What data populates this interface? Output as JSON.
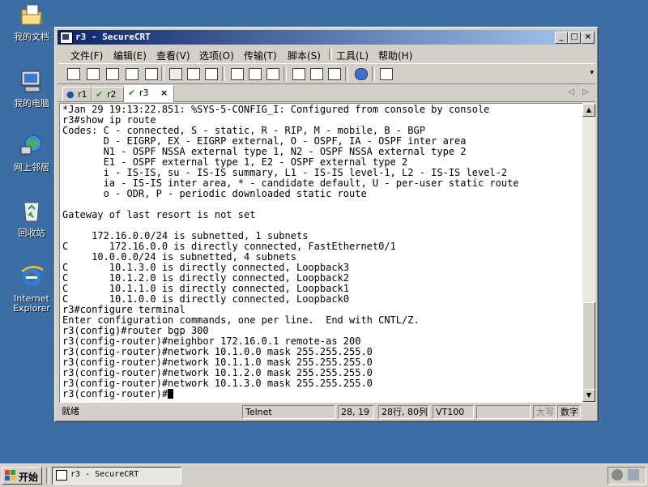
{
  "desktop": {
    "icons": [
      {
        "label": "我的文档",
        "icon": "my-documents-icon"
      },
      {
        "label": "我的电脑",
        "icon": "my-computer-icon"
      },
      {
        "label": "网上邻居",
        "icon": "network-icon"
      },
      {
        "label": "回收站",
        "icon": "recycle-bin-icon"
      },
      {
        "label": "Internet Explorer",
        "icon": "internet-explorer-icon"
      }
    ]
  },
  "window": {
    "title": "r3 - SecureCRT",
    "controls": {
      "minimize": "_",
      "maximize": "□",
      "close": "×"
    },
    "menu": [
      "文件(F)",
      "编辑(E)",
      "查看(V)",
      "选项(O)",
      "传输(T)",
      "脚本(S)",
      "工具(L)",
      "帮助(H)"
    ],
    "tabs": [
      {
        "label": "r1",
        "status": "info"
      },
      {
        "label": "r2",
        "status": "connected"
      },
      {
        "label": "r3",
        "status": "connected",
        "active": true,
        "close": "×"
      }
    ],
    "tab_nav": {
      "left": "◁",
      "right": "▷"
    }
  },
  "terminal": {
    "lines": [
      "*Jan 29 19:13:22.851: %SYS-5-CONFIG_I: Configured from console by console",
      "r3#show ip route",
      "Codes: C - connected, S - static, R - RIP, M - mobile, B - BGP",
      "       D - EIGRP, EX - EIGRP external, O - OSPF, IA - OSPF inter area",
      "       N1 - OSPF NSSA external type 1, N2 - OSPF NSSA external type 2",
      "       E1 - OSPF external type 1, E2 - OSPF external type 2",
      "       i - IS-IS, su - IS-IS summary, L1 - IS-IS level-1, L2 - IS-IS level-2",
      "       ia - IS-IS inter area, * - candidate default, U - per-user static route",
      "       o - ODR, P - periodic downloaded static route",
      "",
      "Gateway of last resort is not set",
      "",
      "     172.16.0.0/24 is subnetted, 1 subnets",
      "C       172.16.0.0 is directly connected, FastEthernet0/1",
      "     10.0.0.0/24 is subnetted, 4 subnets",
      "C       10.1.3.0 is directly connected, Loopback3",
      "C       10.1.2.0 is directly connected, Loopback2",
      "C       10.1.1.0 is directly connected, Loopback1",
      "C       10.1.0.0 is directly connected, Loopback0",
      "r3#configure terminal",
      "Enter configuration commands, one per line.  End with CNTL/Z.",
      "r3(config)#router bgp 300",
      "r3(config-router)#neighbor 172.16.0.1 remote-as 200",
      "r3(config-router)#network 10.1.0.0 mask 255.255.255.0",
      "r3(config-router)#network 10.1.1.0 mask 255.255.255.0",
      "r3(config-router)#network 10.1.2.0 mask 255.255.255.0",
      "r3(config-router)#network 10.1.3.0 mask 255.255.255.0",
      "r3(config-router)#"
    ]
  },
  "statusbar": {
    "ready": "就绪",
    "protocol": "Telnet",
    "cursor_pos": "28, 19",
    "rows_cols": "28行, 80列",
    "emulation": "VT100",
    "blank": "",
    "caps": "大写",
    "num": "数字"
  },
  "taskbar": {
    "start": "开始",
    "task": "r3 - SecureCRT"
  },
  "colors": {
    "desktop": "#3a6ea5",
    "title_active": "#0a246a",
    "tab_connected": "#2a9a2a",
    "tab_info": "#1a4fc0"
  }
}
